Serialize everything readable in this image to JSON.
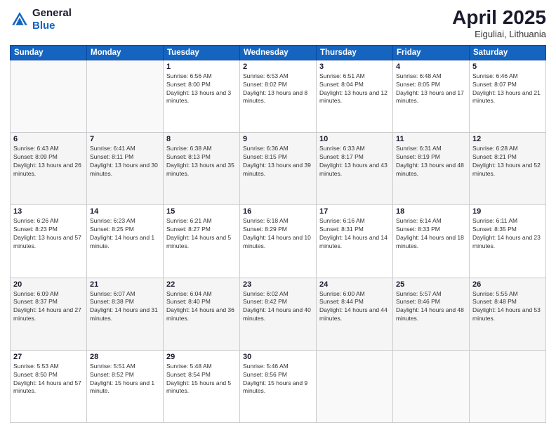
{
  "logo": {
    "line1": "General",
    "line2": "Blue"
  },
  "title": "April 2025",
  "subtitle": "Eiguliai, Lithuania",
  "weekdays": [
    "Sunday",
    "Monday",
    "Tuesday",
    "Wednesday",
    "Thursday",
    "Friday",
    "Saturday"
  ],
  "weeks": [
    [
      {
        "day": "",
        "sunrise": "",
        "sunset": "",
        "daylight": ""
      },
      {
        "day": "",
        "sunrise": "",
        "sunset": "",
        "daylight": ""
      },
      {
        "day": "1",
        "sunrise": "Sunrise: 6:56 AM",
        "sunset": "Sunset: 8:00 PM",
        "daylight": "Daylight: 13 hours and 3 minutes."
      },
      {
        "day": "2",
        "sunrise": "Sunrise: 6:53 AM",
        "sunset": "Sunset: 8:02 PM",
        "daylight": "Daylight: 13 hours and 8 minutes."
      },
      {
        "day": "3",
        "sunrise": "Sunrise: 6:51 AM",
        "sunset": "Sunset: 8:04 PM",
        "daylight": "Daylight: 13 hours and 12 minutes."
      },
      {
        "day": "4",
        "sunrise": "Sunrise: 6:48 AM",
        "sunset": "Sunset: 8:05 PM",
        "daylight": "Daylight: 13 hours and 17 minutes."
      },
      {
        "day": "5",
        "sunrise": "Sunrise: 6:46 AM",
        "sunset": "Sunset: 8:07 PM",
        "daylight": "Daylight: 13 hours and 21 minutes."
      }
    ],
    [
      {
        "day": "6",
        "sunrise": "Sunrise: 6:43 AM",
        "sunset": "Sunset: 8:09 PM",
        "daylight": "Daylight: 13 hours and 26 minutes."
      },
      {
        "day": "7",
        "sunrise": "Sunrise: 6:41 AM",
        "sunset": "Sunset: 8:11 PM",
        "daylight": "Daylight: 13 hours and 30 minutes."
      },
      {
        "day": "8",
        "sunrise": "Sunrise: 6:38 AM",
        "sunset": "Sunset: 8:13 PM",
        "daylight": "Daylight: 13 hours and 35 minutes."
      },
      {
        "day": "9",
        "sunrise": "Sunrise: 6:36 AM",
        "sunset": "Sunset: 8:15 PM",
        "daylight": "Daylight: 13 hours and 39 minutes."
      },
      {
        "day": "10",
        "sunrise": "Sunrise: 6:33 AM",
        "sunset": "Sunset: 8:17 PM",
        "daylight": "Daylight: 13 hours and 43 minutes."
      },
      {
        "day": "11",
        "sunrise": "Sunrise: 6:31 AM",
        "sunset": "Sunset: 8:19 PM",
        "daylight": "Daylight: 13 hours and 48 minutes."
      },
      {
        "day": "12",
        "sunrise": "Sunrise: 6:28 AM",
        "sunset": "Sunset: 8:21 PM",
        "daylight": "Daylight: 13 hours and 52 minutes."
      }
    ],
    [
      {
        "day": "13",
        "sunrise": "Sunrise: 6:26 AM",
        "sunset": "Sunset: 8:23 PM",
        "daylight": "Daylight: 13 hours and 57 minutes."
      },
      {
        "day": "14",
        "sunrise": "Sunrise: 6:23 AM",
        "sunset": "Sunset: 8:25 PM",
        "daylight": "Daylight: 14 hours and 1 minute."
      },
      {
        "day": "15",
        "sunrise": "Sunrise: 6:21 AM",
        "sunset": "Sunset: 8:27 PM",
        "daylight": "Daylight: 14 hours and 5 minutes."
      },
      {
        "day": "16",
        "sunrise": "Sunrise: 6:18 AM",
        "sunset": "Sunset: 8:29 PM",
        "daylight": "Daylight: 14 hours and 10 minutes."
      },
      {
        "day": "17",
        "sunrise": "Sunrise: 6:16 AM",
        "sunset": "Sunset: 8:31 PM",
        "daylight": "Daylight: 14 hours and 14 minutes."
      },
      {
        "day": "18",
        "sunrise": "Sunrise: 6:14 AM",
        "sunset": "Sunset: 8:33 PM",
        "daylight": "Daylight: 14 hours and 18 minutes."
      },
      {
        "day": "19",
        "sunrise": "Sunrise: 6:11 AM",
        "sunset": "Sunset: 8:35 PM",
        "daylight": "Daylight: 14 hours and 23 minutes."
      }
    ],
    [
      {
        "day": "20",
        "sunrise": "Sunrise: 6:09 AM",
        "sunset": "Sunset: 8:37 PM",
        "daylight": "Daylight: 14 hours and 27 minutes."
      },
      {
        "day": "21",
        "sunrise": "Sunrise: 6:07 AM",
        "sunset": "Sunset: 8:38 PM",
        "daylight": "Daylight: 14 hours and 31 minutes."
      },
      {
        "day": "22",
        "sunrise": "Sunrise: 6:04 AM",
        "sunset": "Sunset: 8:40 PM",
        "daylight": "Daylight: 14 hours and 36 minutes."
      },
      {
        "day": "23",
        "sunrise": "Sunrise: 6:02 AM",
        "sunset": "Sunset: 8:42 PM",
        "daylight": "Daylight: 14 hours and 40 minutes."
      },
      {
        "day": "24",
        "sunrise": "Sunrise: 6:00 AM",
        "sunset": "Sunset: 8:44 PM",
        "daylight": "Daylight: 14 hours and 44 minutes."
      },
      {
        "day": "25",
        "sunrise": "Sunrise: 5:57 AM",
        "sunset": "Sunset: 8:46 PM",
        "daylight": "Daylight: 14 hours and 48 minutes."
      },
      {
        "day": "26",
        "sunrise": "Sunrise: 5:55 AM",
        "sunset": "Sunset: 8:48 PM",
        "daylight": "Daylight: 14 hours and 53 minutes."
      }
    ],
    [
      {
        "day": "27",
        "sunrise": "Sunrise: 5:53 AM",
        "sunset": "Sunset: 8:50 PM",
        "daylight": "Daylight: 14 hours and 57 minutes."
      },
      {
        "day": "28",
        "sunrise": "Sunrise: 5:51 AM",
        "sunset": "Sunset: 8:52 PM",
        "daylight": "Daylight: 15 hours and 1 minute."
      },
      {
        "day": "29",
        "sunrise": "Sunrise: 5:48 AM",
        "sunset": "Sunset: 8:54 PM",
        "daylight": "Daylight: 15 hours and 5 minutes."
      },
      {
        "day": "30",
        "sunrise": "Sunrise: 5:46 AM",
        "sunset": "Sunset: 8:56 PM",
        "daylight": "Daylight: 15 hours and 9 minutes."
      },
      {
        "day": "",
        "sunrise": "",
        "sunset": "",
        "daylight": ""
      },
      {
        "day": "",
        "sunrise": "",
        "sunset": "",
        "daylight": ""
      },
      {
        "day": "",
        "sunrise": "",
        "sunset": "",
        "daylight": ""
      }
    ]
  ]
}
